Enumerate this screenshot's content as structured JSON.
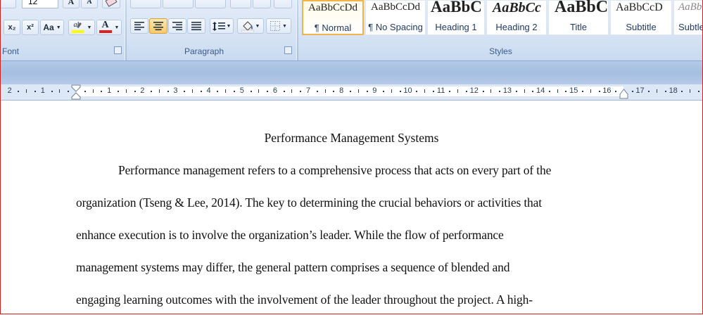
{
  "ribbon": {
    "font_group": {
      "label": "Font",
      "font_size": "12",
      "buttons": {
        "subscript": "x₂",
        "superscript": "x²",
        "change_case": "Aa"
      }
    },
    "paragraph_group": {
      "label": "Paragraph"
    },
    "styles_group": {
      "label": "Styles",
      "items": [
        {
          "sample": "AaBbCcDd",
          "name": "¶ Normal"
        },
        {
          "sample": "AaBbCcDd",
          "name": "¶ No Spacing"
        },
        {
          "sample": "AaBbC",
          "name": "Heading 1"
        },
        {
          "sample": "AaBbCc",
          "name": "Heading 2"
        },
        {
          "sample": "AaBbC",
          "name": "Title"
        },
        {
          "sample": "AaBbCcD",
          "name": "Subtitle"
        },
        {
          "sample": "AaBbCcL",
          "name": "Subtle"
        }
      ]
    },
    "colors": {
      "highlight": "#ffff00",
      "font_color": "#e02020",
      "accent": "#f2b44a"
    }
  },
  "ruler": {
    "numbers": [
      "2",
      "1",
      "1",
      "2",
      "3",
      "4",
      "5",
      "6",
      "7",
      "8",
      "9",
      "10",
      "11",
      "12",
      "13",
      "14",
      "15",
      "16",
      "17",
      "18"
    ]
  },
  "document": {
    "title": "Performance Management Systems",
    "lines": [
      "Performance management refers to a comprehensive process that acts on every part of the",
      "organization (Tseng & Lee, 2014). The key to determining the crucial behaviors or activities that",
      "enhance execution is to involve the organization’s leader. While the flow of performance",
      "management systems may differ, the general pattern comprises a sequence of blended and",
      "engaging learning outcomes with the involvement of the leader throughout the project. A high-"
    ]
  }
}
